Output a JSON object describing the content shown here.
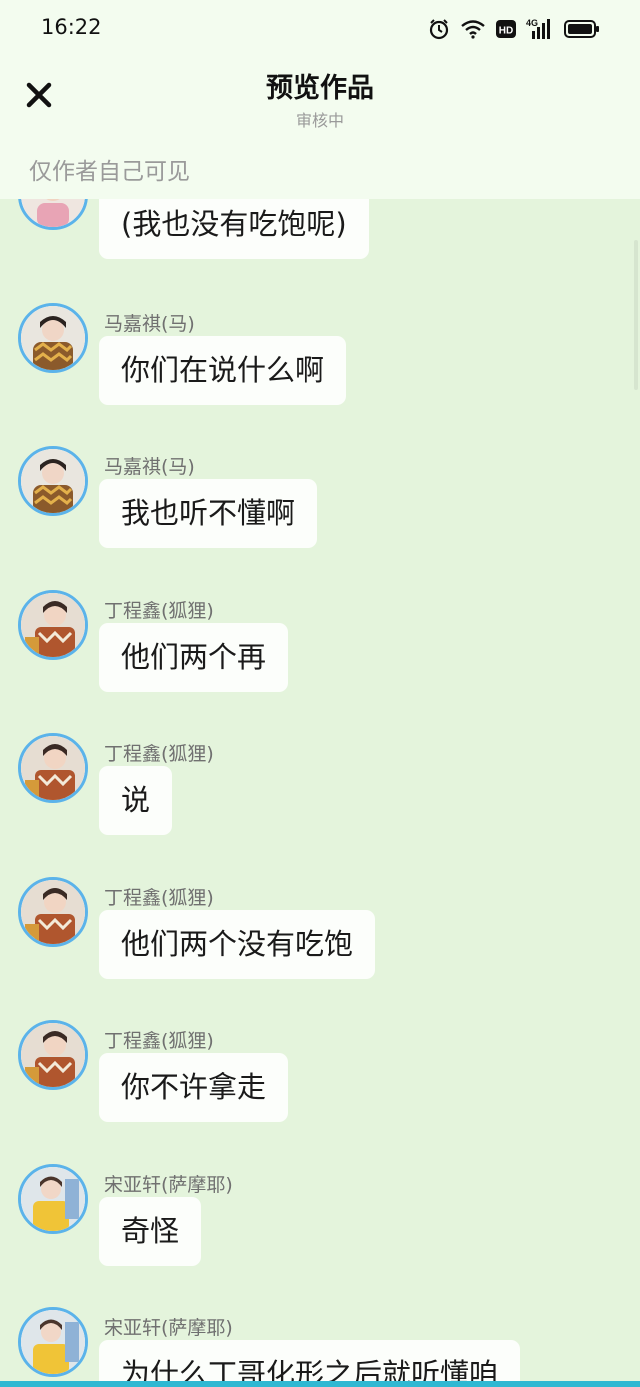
{
  "status_bar": {
    "time": "16:22",
    "icons": [
      "alarm-icon",
      "wifi-icon",
      "hd-icon",
      "signal-4g-icon",
      "battery-icon"
    ],
    "network_label": "4G",
    "hd_label": "HD"
  },
  "header": {
    "title": "预览作品",
    "subtitle": "审核中",
    "close_icon": "close-icon"
  },
  "visibility_note": "仅作者自己可见",
  "colors": {
    "header_bg": "#f3fcef",
    "chat_bg": "#e4f4dc",
    "bubble_bg": "#fcfefb",
    "avatar_ring": "#5bb3ea",
    "accent_bar": "#2fb8d2"
  },
  "messages": [
    {
      "sender": "",
      "text": "(我也没有吃饱呢)",
      "avatar": "avatar-pink"
    },
    {
      "sender": "马嘉祺(马)",
      "text": "你们在说什么啊",
      "avatar": "avatar-ma"
    },
    {
      "sender": "马嘉祺(马)",
      "text": "我也听不懂啊",
      "avatar": "avatar-ma"
    },
    {
      "sender": "丁程鑫(狐狸)",
      "text": "他们两个再",
      "avatar": "avatar-ding"
    },
    {
      "sender": "丁程鑫(狐狸)",
      "text": "说",
      "avatar": "avatar-ding"
    },
    {
      "sender": "丁程鑫(狐狸)",
      "text": "他们两个没有吃饱",
      "avatar": "avatar-ding"
    },
    {
      "sender": "丁程鑫(狐狸)",
      "text": "你不许拿走",
      "avatar": "avatar-ding"
    },
    {
      "sender": "宋亚轩(萨摩耶)",
      "text": "奇怪",
      "avatar": "avatar-song"
    },
    {
      "sender": "宋亚轩(萨摩耶)",
      "text": "为什么丁哥化形之后就听懂咱",
      "avatar": "avatar-song"
    }
  ]
}
